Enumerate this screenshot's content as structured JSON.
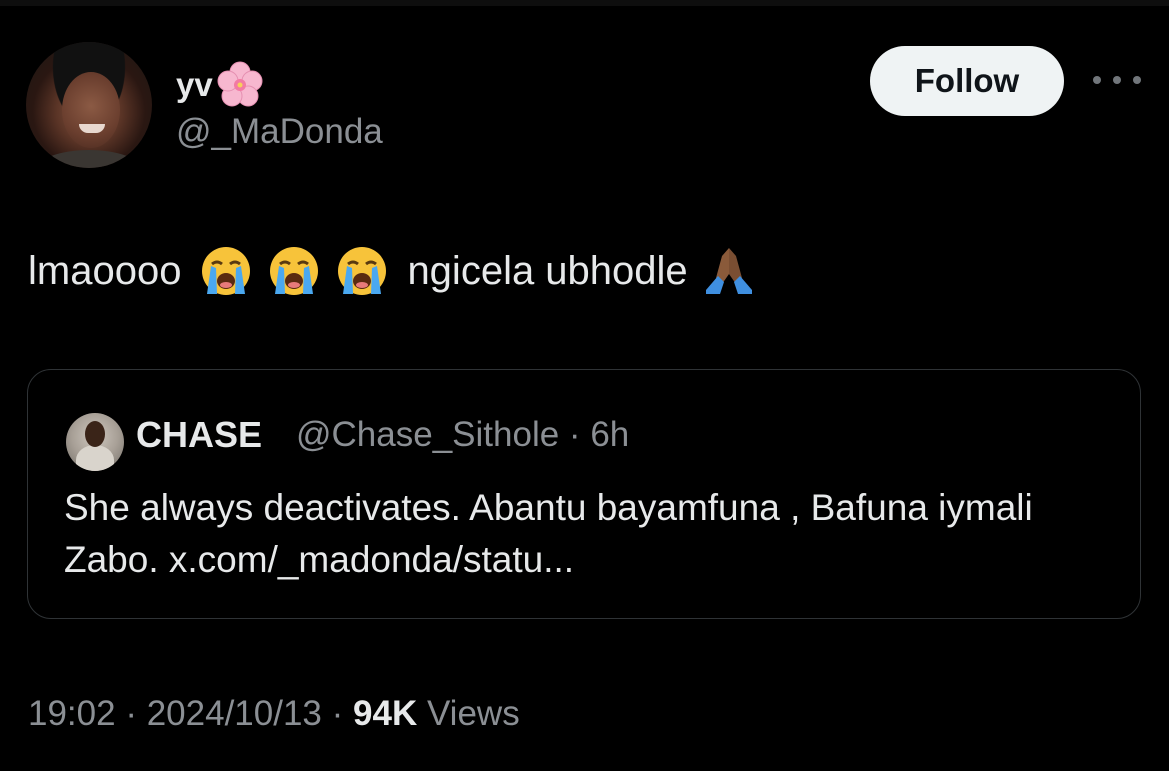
{
  "author": {
    "display_name": "yv",
    "name_emoji": "cherry-blossom",
    "handle": "@_MaDonda",
    "follow_label": "Follow"
  },
  "tweet": {
    "text_part1": "lmaoooo",
    "emojis": [
      "loudly-crying-face",
      "loudly-crying-face",
      "loudly-crying-face"
    ],
    "text_part2": "ngicela ubhodle",
    "end_emoji": "folded-hands"
  },
  "quoted": {
    "display_name": "CHASE",
    "handle": "@Chase_Sithole",
    "separator": "·",
    "time": "6h",
    "text": "She always deactivates. Abantu bayamfuna , Bafuna iymali Zabo. x.com/_madonda/statu..."
  },
  "meta": {
    "time": "19:02",
    "separator": "·",
    "date": "2024/10/13",
    "views_count": "94K",
    "views_label": "Views"
  },
  "colors": {
    "background": "#000000",
    "text_primary": "#e7e9ea",
    "text_secondary": "#8b8f94",
    "border": "#2f3336",
    "follow_bg": "#eff3f4"
  }
}
